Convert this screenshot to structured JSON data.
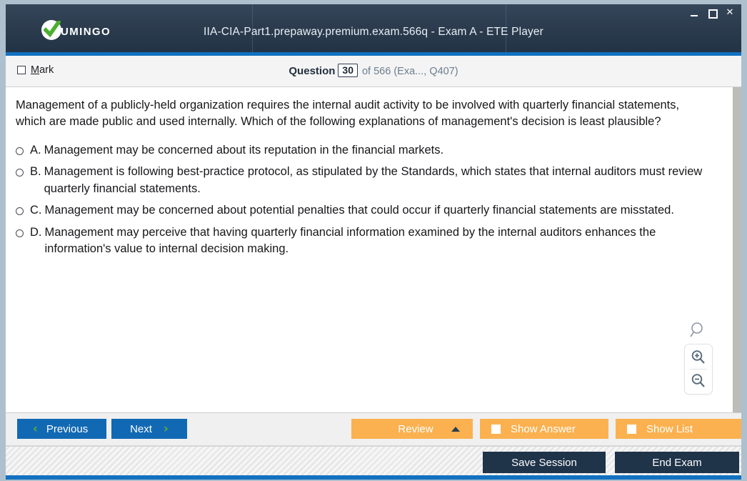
{
  "window": {
    "title": "IIA-CIA-Part1.prepaway.premium.exam.566q - Exam A - ETE Player",
    "logo_text": "UMINGO",
    "controls": {
      "minimize": "minimize-icon",
      "maximize": "maximize-icon",
      "close": "✕"
    },
    "accent_blue": "#1271c0",
    "titlebar_dark": "#2c3c4e"
  },
  "header": {
    "mark_label_pre": "",
    "mark_accelerator": "M",
    "mark_label_rest": "ark",
    "question_word": "Question",
    "question_number": "30",
    "question_of": "of 566 (Exa..., Q407)"
  },
  "question": {
    "text": "Management of a publicly-held organization requires the internal audit activity to be involved with quarterly financial statements, which are made public and used internally. Which of the following explanations of management's decision is least plausible?",
    "options": [
      {
        "letter": "A.",
        "text": "Management may be concerned about its reputation in the financial markets.",
        "selected": false
      },
      {
        "letter": "B.",
        "text": "Management is following best-practice protocol, as stipulated by the Standards, which states that internal auditors must review quarterly financial statements.",
        "selected": false
      },
      {
        "letter": "C.",
        "text": "Management may be concerned about potential penalties that could occur if quarterly financial statements are misstated.",
        "selected": false
      },
      {
        "letter": "D.",
        "text": "Management may perceive that having quarterly financial information examined by the internal auditors enhances the information's value to internal decision making.",
        "selected": false
      }
    ]
  },
  "zoom_tools": {
    "search": "magnifier-icon",
    "zoom_in": "zoom-in-icon",
    "zoom_out": "zoom-out-icon"
  },
  "buttons": {
    "previous": "Previous",
    "next": "Next",
    "review": "Review",
    "show_answer": "Show Answer",
    "show_list": "Show List",
    "save_session": "Save Session",
    "end_exam": "End Exam",
    "prev_chevron": "‹",
    "next_chevron": "›",
    "nav_blue": "#1169b4",
    "chevron_green": "#5ab031",
    "orange": "#fbb14f",
    "dark_navy": "#1f3349"
  }
}
